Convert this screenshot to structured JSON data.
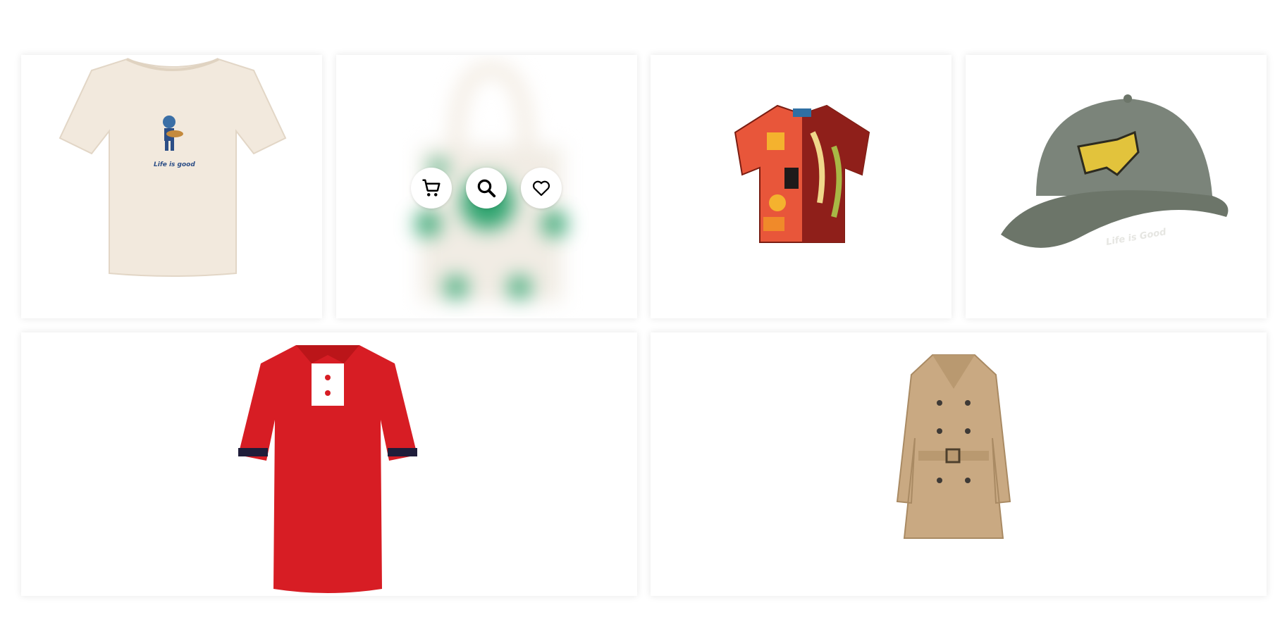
{
  "products": [
    {
      "name": "cream graphic tee",
      "print_text": "Life is good",
      "color": "#f2e9dd"
    },
    {
      "name": "polka dot tote bag",
      "state": "hover",
      "color": "#2fa46f"
    },
    {
      "name": "printed camp shirt",
      "color": "#d3341f"
    },
    {
      "name": "dog patch cap",
      "print_text": "Life is Good",
      "color": "#7b847a"
    },
    {
      "name": "red polo shirt",
      "color": "#d71d24"
    },
    {
      "name": "beige trench coat",
      "color": "#c9a982"
    }
  ],
  "actions": {
    "cart_label": "Add to cart",
    "search_label": "Quick view",
    "wishlist_label": "Add to wishlist",
    "cart_icon": "cart-icon",
    "search_icon": "search-icon",
    "wishlist_icon": "heart-icon"
  }
}
